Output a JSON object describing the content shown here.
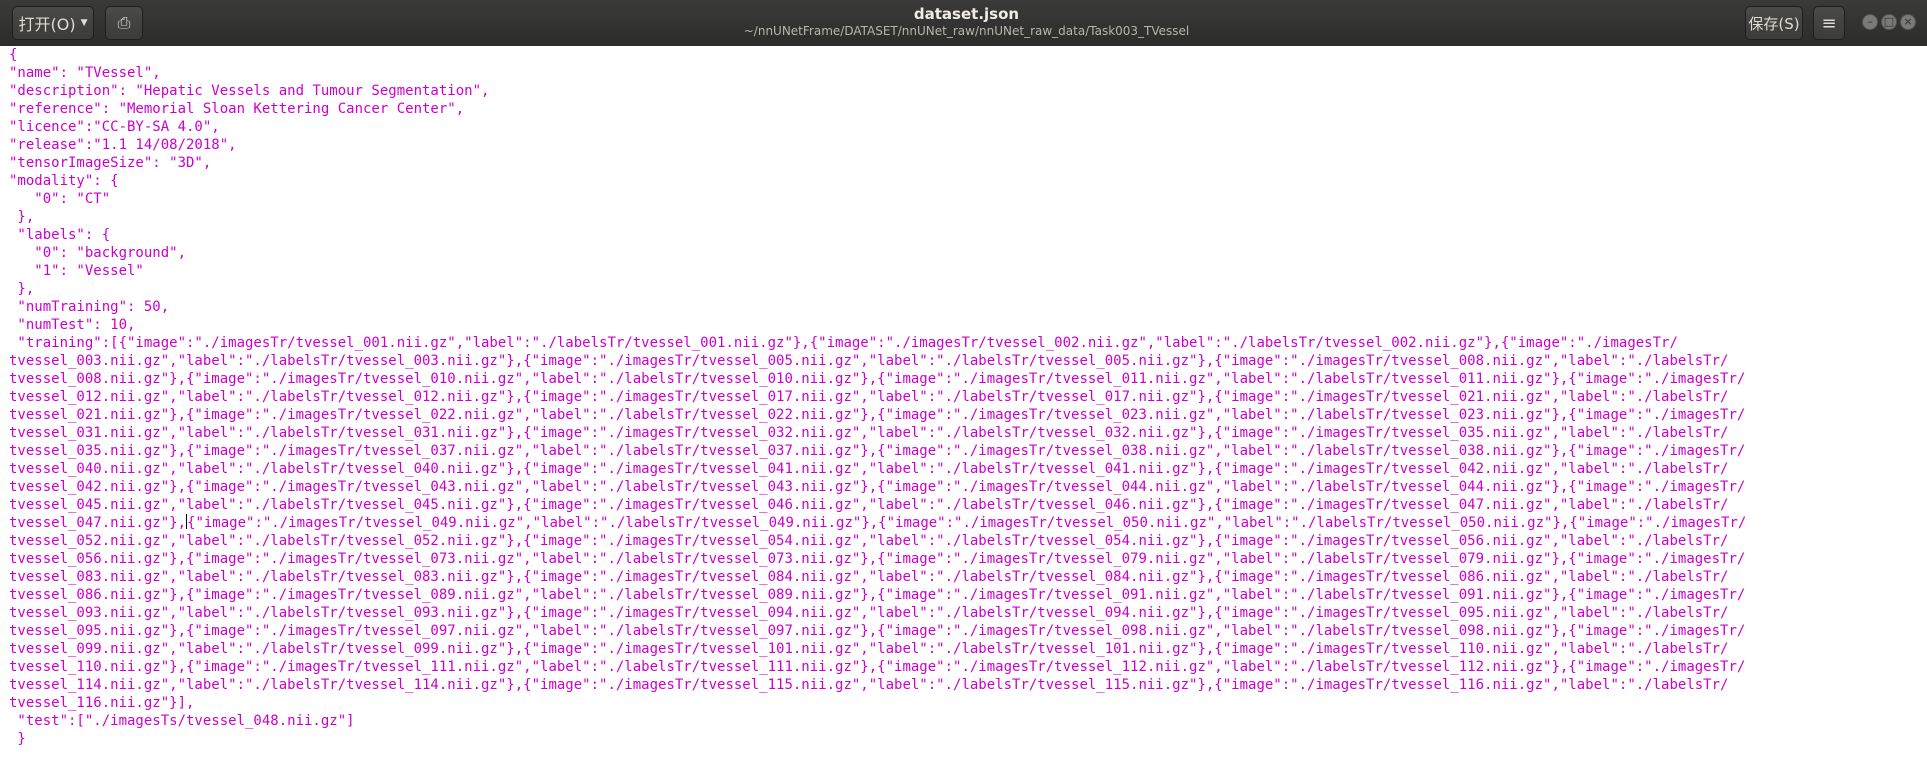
{
  "toolbar": {
    "open_label": "打开(O)",
    "save_label": "保存(S)",
    "menu_glyph": "≡",
    "pin_glyph": "⎙"
  },
  "window": {
    "title": "dataset.json",
    "path": "~/nnUNetFrame/DATASET/nnUNet_raw/nnUNet_raw_data/Task003_TVessel"
  },
  "editor": {
    "lines": [
      "{",
      "\"name\": \"TVessel\",",
      "\"description\": \"Hepatic Vessels and Tumour Segmentation\",",
      "\"reference\": \"Memorial Sloan Kettering Cancer Center\",",
      "\"licence\":\"CC-BY-SA 4.0\",",
      "\"release\":\"1.1 14/08/2018\",",
      "\"tensorImageSize\": \"3D\",",
      "\"modality\": {",
      "   \"0\": \"CT\"",
      " },",
      " \"labels\": {",
      "   \"0\": \"background\",",
      "   \"1\": \"Vessel\"",
      " },",
      " \"numTraining\": 50,",
      " \"numTest\": 10,",
      " \"training\":[{\"image\":\"./imagesTr/tvessel_001.nii.gz\",\"label\":\"./labelsTr/tvessel_001.nii.gz\"},{\"image\":\"./imagesTr/tvessel_002.nii.gz\",\"label\":\"./labelsTr/tvessel_002.nii.gz\"},{\"image\":\"./imagesTr/",
      "tvessel_003.nii.gz\",\"label\":\"./labelsTr/tvessel_003.nii.gz\"},{\"image\":\"./imagesTr/tvessel_005.nii.gz\",\"label\":\"./labelsTr/tvessel_005.nii.gz\"},{\"image\":\"./imagesTr/tvessel_008.nii.gz\",\"label\":\"./labelsTr/",
      "tvessel_008.nii.gz\"},{\"image\":\"./imagesTr/tvessel_010.nii.gz\",\"label\":\"./labelsTr/tvessel_010.nii.gz\"},{\"image\":\"./imagesTr/tvessel_011.nii.gz\",\"label\":\"./labelsTr/tvessel_011.nii.gz\"},{\"image\":\"./imagesTr/",
      "tvessel_012.nii.gz\",\"label\":\"./labelsTr/tvessel_012.nii.gz\"},{\"image\":\"./imagesTr/tvessel_017.nii.gz\",\"label\":\"./labelsTr/tvessel_017.nii.gz\"},{\"image\":\"./imagesTr/tvessel_021.nii.gz\",\"label\":\"./labelsTr/",
      "tvessel_021.nii.gz\"},{\"image\":\"./imagesTr/tvessel_022.nii.gz\",\"label\":\"./labelsTr/tvessel_022.nii.gz\"},{\"image\":\"./imagesTr/tvessel_023.nii.gz\",\"label\":\"./labelsTr/tvessel_023.nii.gz\"},{\"image\":\"./imagesTr/",
      "tvessel_031.nii.gz\",\"label\":\"./labelsTr/tvessel_031.nii.gz\"},{\"image\":\"./imagesTr/tvessel_032.nii.gz\",\"label\":\"./labelsTr/tvessel_032.nii.gz\"},{\"image\":\"./imagesTr/tvessel_035.nii.gz\",\"label\":\"./labelsTr/",
      "tvessel_035.nii.gz\"},{\"image\":\"./imagesTr/tvessel_037.nii.gz\",\"label\":\"./labelsTr/tvessel_037.nii.gz\"},{\"image\":\"./imagesTr/tvessel_038.nii.gz\",\"label\":\"./labelsTr/tvessel_038.nii.gz\"},{\"image\":\"./imagesTr/",
      "tvessel_040.nii.gz\",\"label\":\"./labelsTr/tvessel_040.nii.gz\"},{\"image\":\"./imagesTr/tvessel_041.nii.gz\",\"label\":\"./labelsTr/tvessel_041.nii.gz\"},{\"image\":\"./imagesTr/tvessel_042.nii.gz\",\"label\":\"./labelsTr/",
      "tvessel_042.nii.gz\"},{\"image\":\"./imagesTr/tvessel_043.nii.gz\",\"label\":\"./labelsTr/tvessel_043.nii.gz\"},{\"image\":\"./imagesTr/tvessel_044.nii.gz\",\"label\":\"./labelsTr/tvessel_044.nii.gz\"},{\"image\":\"./imagesTr/",
      "tvessel_045.nii.gz\",\"label\":\"./labelsTr/tvessel_045.nii.gz\"},{\"image\":\"./imagesTr/tvessel_046.nii.gz\",\"label\":\"./labelsTr/tvessel_046.nii.gz\"},{\"image\":\"./imagesTr/tvessel_047.nii.gz\",\"label\":\"./labelsTr/",
      "tvessel_047.nii.gz\"},",
      "tvessel_052.nii.gz\",\"label\":\"./labelsTr/tvessel_052.nii.gz\"},{\"image\":\"./imagesTr/tvessel_054.nii.gz\",\"label\":\"./labelsTr/tvessel_054.nii.gz\"},{\"image\":\"./imagesTr/tvessel_056.nii.gz\",\"label\":\"./labelsTr/",
      "tvessel_056.nii.gz\"},{\"image\":\"./imagesTr/tvessel_073.nii.gz\",\"label\":\"./labelsTr/tvessel_073.nii.gz\"},{\"image\":\"./imagesTr/tvessel_079.nii.gz\",\"label\":\"./labelsTr/tvessel_079.nii.gz\"},{\"image\":\"./imagesTr/",
      "tvessel_083.nii.gz\",\"label\":\"./labelsTr/tvessel_083.nii.gz\"},{\"image\":\"./imagesTr/tvessel_084.nii.gz\",\"label\":\"./labelsTr/tvessel_084.nii.gz\"},{\"image\":\"./imagesTr/tvessel_086.nii.gz\",\"label\":\"./labelsTr/",
      "tvessel_086.nii.gz\"},{\"image\":\"./imagesTr/tvessel_089.nii.gz\",\"label\":\"./labelsTr/tvessel_089.nii.gz\"},{\"image\":\"./imagesTr/tvessel_091.nii.gz\",\"label\":\"./labelsTr/tvessel_091.nii.gz\"},{\"image\":\"./imagesTr/",
      "tvessel_093.nii.gz\",\"label\":\"./labelsTr/tvessel_093.nii.gz\"},{\"image\":\"./imagesTr/tvessel_094.nii.gz\",\"label\":\"./labelsTr/tvessel_094.nii.gz\"},{\"image\":\"./imagesTr/tvessel_095.nii.gz\",\"label\":\"./labelsTr/",
      "tvessel_095.nii.gz\"},{\"image\":\"./imagesTr/tvessel_097.nii.gz\",\"label\":\"./labelsTr/tvessel_097.nii.gz\"},{\"image\":\"./imagesTr/tvessel_098.nii.gz\",\"label\":\"./labelsTr/tvessel_098.nii.gz\"},{\"image\":\"./imagesTr/",
      "tvessel_099.nii.gz\",\"label\":\"./labelsTr/tvessel_099.nii.gz\"},{\"image\":\"./imagesTr/tvessel_101.nii.gz\",\"label\":\"./labelsTr/tvessel_101.nii.gz\"},{\"image\":\"./imagesTr/tvessel_110.nii.gz\",\"label\":\"./labelsTr/",
      "tvessel_110.nii.gz\"},{\"image\":\"./imagesTr/tvessel_111.nii.gz\",\"label\":\"./labelsTr/tvessel_111.nii.gz\"},{\"image\":\"./imagesTr/tvessel_112.nii.gz\",\"label\":\"./labelsTr/tvessel_112.nii.gz\"},{\"image\":\"./imagesTr/",
      "tvessel_114.nii.gz\",\"label\":\"./labelsTr/tvessel_114.nii.gz\"},{\"image\":\"./imagesTr/tvessel_115.nii.gz\",\"label\":\"./labelsTr/tvessel_115.nii.gz\"},{\"image\":\"./imagesTr/tvessel_116.nii.gz\",\"label\":\"./labelsTr/",
      "tvessel_116.nii.gz\"}],",
      " \"test\":[\"./imagesTs/tvessel_048.nii.gz\"]",
      " }"
    ],
    "caret_line_rest": "{\"image\":\"./imagesTr/tvessel_049.nii.gz\",\"label\":\"./labelsTr/tvessel_049.nii.gz\"},{\"image\":\"./imagesTr/tvessel_050.nii.gz\",\"label\":\"./labelsTr/tvessel_050.nii.gz\"},{\"image\":\"./imagesTr/"
  },
  "colors": {
    "text": "#cc00cc",
    "titlebar": "#2e2e2c"
  }
}
